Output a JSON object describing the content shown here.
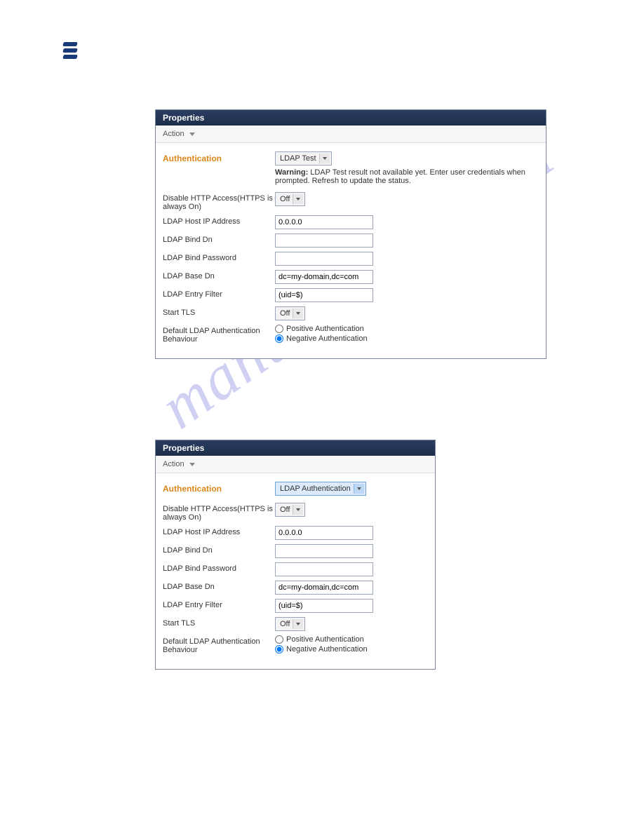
{
  "watermark": "manualshive.com",
  "panel1": {
    "header": "Properties",
    "action_label": "Action",
    "section_label": "Authentication",
    "auth_select": "LDAP Test",
    "warning_prefix": "Warning:",
    "warning_text": " LDAP Test result not available yet. Enter user credentials when prompted. Refresh to update the status.",
    "rows": {
      "disable_http": {
        "label": "Disable HTTP Access(HTTPS is always On)",
        "value": "Off"
      },
      "ldap_host": {
        "label": "LDAP Host IP Address",
        "value": "0.0.0.0"
      },
      "ldap_bind_dn": {
        "label": "LDAP Bind Dn",
        "value": ""
      },
      "ldap_bind_pw": {
        "label": "LDAP Bind Password",
        "value": ""
      },
      "ldap_base_dn": {
        "label": "LDAP Base Dn",
        "value": "dc=my-domain,dc=com"
      },
      "ldap_filter": {
        "label": "LDAP Entry Filter",
        "value": "(uid=$)"
      },
      "start_tls": {
        "label": "Start TLS",
        "value": "Off"
      },
      "default_auth": {
        "label": "Default LDAP Authentication Behaviour",
        "opt1": "Positive Authentication",
        "opt2": "Negative Authentication"
      }
    }
  },
  "panel2": {
    "header": "Properties",
    "action_label": "Action",
    "section_label": "Authentication",
    "auth_select": "LDAP Authentication",
    "rows": {
      "disable_http": {
        "label": "Disable HTTP Access(HTTPS is always On)",
        "value": "Off"
      },
      "ldap_host": {
        "label": "LDAP Host IP Address",
        "value": "0.0.0.0"
      },
      "ldap_bind_dn": {
        "label": "LDAP Bind Dn",
        "value": ""
      },
      "ldap_bind_pw": {
        "label": "LDAP Bind Password",
        "value": ""
      },
      "ldap_base_dn": {
        "label": "LDAP Base Dn",
        "value": "dc=my-domain,dc=com"
      },
      "ldap_filter": {
        "label": "LDAP Entry Filter",
        "value": "(uid=$)"
      },
      "start_tls": {
        "label": "Start TLS",
        "value": "Off"
      },
      "default_auth": {
        "label": "Default LDAP Authentication Behaviour",
        "opt1": "Positive Authentication",
        "opt2": "Negative Authentication"
      }
    }
  }
}
